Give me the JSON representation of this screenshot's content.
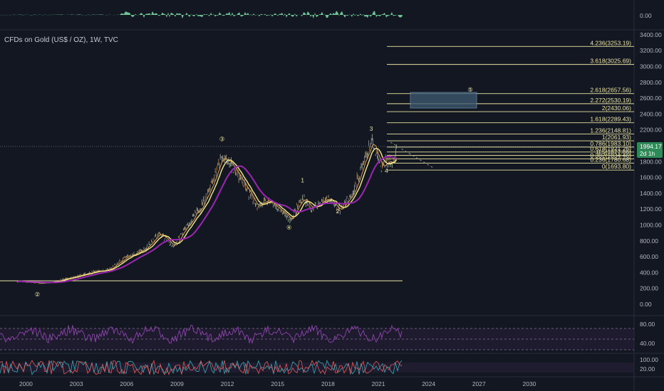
{
  "header": {
    "symbol_title": "CFDs on Gold (US$ / OZ), 1W, TVC"
  },
  "colors": {
    "background": "#131722",
    "pane_border": "#2a2e39",
    "volume_osc": "#7ee2a8",
    "fib_line": "#e8e2a0",
    "ma_fast": "#e0a050",
    "ma_mid": "#f0e88a",
    "ma_slow": "#9b27b0",
    "rsi": "#8e44ad",
    "stoch_k": "#3ba7b3",
    "stoch_d": "#e05b5b",
    "target_box": "#4c6e8c",
    "price_tag": "#2e8b57"
  },
  "top_pane": {
    "axis_value": "0.00"
  },
  "main_pane": {
    "price_axis": [
      "3400.00",
      "3200.00",
      "3000.00",
      "2800.00",
      "2600.00",
      "2400.00",
      "2200.00",
      "2000.00",
      "1800.00",
      "1600.00",
      "1400.00",
      "1200.00",
      "1000.00",
      "800.00",
      "600.00",
      "400.00",
      "200.00",
      "0.00"
    ],
    "current_price": "1994.17",
    "countdown": "2d 1h",
    "fib_levels": [
      {
        "label": "4.236(3253.19)",
        "price": 3253.19
      },
      {
        "label": "3.618(3025.69)",
        "price": 3025.69
      },
      {
        "label": "2.618(2657.56)",
        "price": 2657.56
      },
      {
        "label": "2.272(2530.19)",
        "price": 2530.19
      },
      {
        "label": "2(2430.06)",
        "price": 2430.06
      },
      {
        "label": "1.618(2289.43)",
        "price": 2289.43
      },
      {
        "label": "1.236(2148.81)",
        "price": 2148.81
      },
      {
        "label": "1(2061.93)",
        "price": 2061.93
      },
      {
        "label": "0.786(1983.10)",
        "price": 1983.1
      },
      {
        "label": "0.618(1921.26)",
        "price": 1921.26
      },
      {
        "label": "0.5(1877.86)",
        "price": 1877.86
      },
      {
        "label": "0.382(1834.46)",
        "price": 1834.46
      },
      {
        "label": "0.236(1780.68)",
        "price": 1780.68
      },
      {
        "label": "0(1693.80)",
        "price": 1693.8
      }
    ],
    "wave_labels": [
      {
        "text": "②",
        "year": 2000.7,
        "price": 100
      },
      {
        "text": "③",
        "year": 2011.7,
        "price": 2060
      },
      {
        "text": "④",
        "year": 2015.7,
        "price": 940
      },
      {
        "text": "⑤",
        "year": 2026.5,
        "price": 2680
      },
      {
        "text": "1",
        "year": 2016.5,
        "price": 1540
      },
      {
        "text": "2",
        "year": 2018.6,
        "price": 1150
      },
      {
        "text": "3",
        "year": 2020.6,
        "price": 2190
      },
      {
        "text": "4",
        "year": 2021.5,
        "price": 1660
      }
    ]
  },
  "rsi_pane": {
    "axis": [
      "80.00",
      "40.00"
    ]
  },
  "stoch_pane": {
    "axis": [
      "100.00",
      "20.00"
    ]
  },
  "time_axis": [
    "2000",
    "2003",
    "2006",
    "2009",
    "2012",
    "2015",
    "2018",
    "2021",
    "2024",
    "2027",
    "2030"
  ]
}
